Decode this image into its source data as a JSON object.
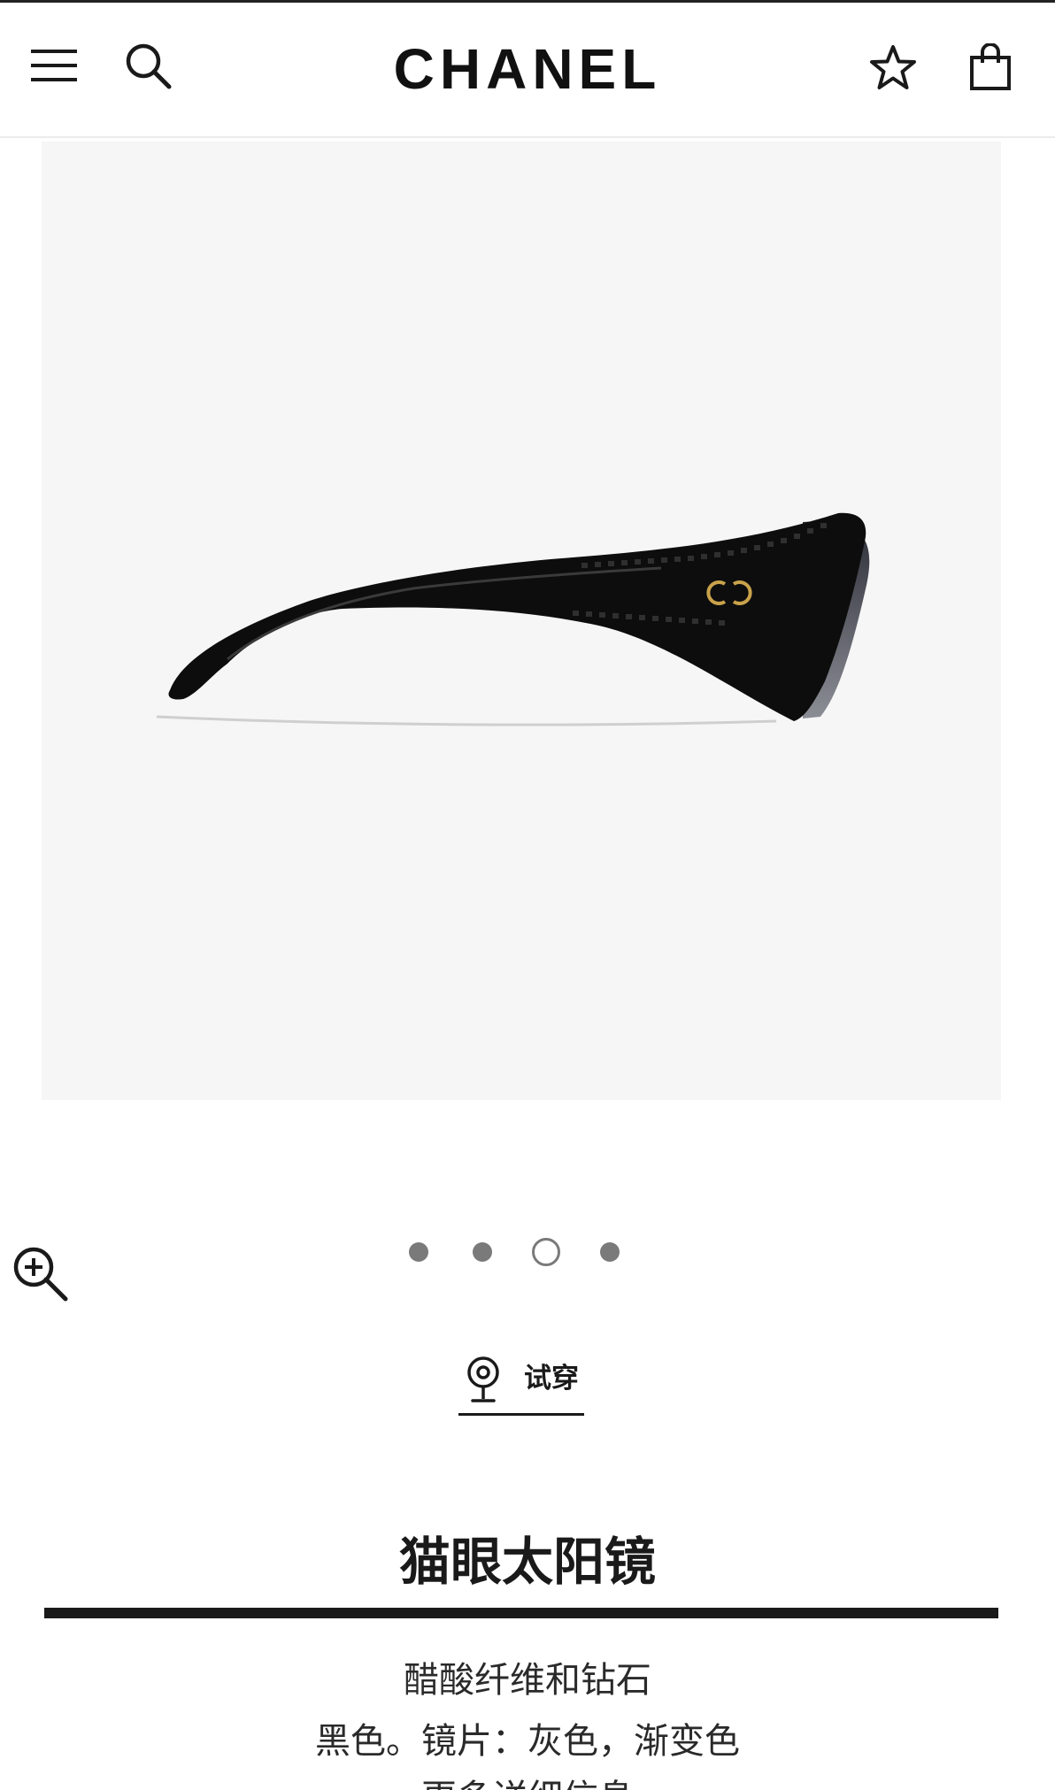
{
  "header": {
    "brand": "CHANEL",
    "icons": [
      "menu-icon",
      "search-icon",
      "star-icon",
      "shopping-bag-icon"
    ]
  },
  "gallery": {
    "image_alt": "黑色猫眼太阳镜侧视图",
    "total_slides": 4,
    "active_slide": 3,
    "zoom_icon": "zoom-in-icon"
  },
  "try_on": {
    "label": "试穿",
    "icon": "location-pin-icon"
  },
  "product": {
    "title": "猫眼太阳镜",
    "material": "醋酸纤维和钻石",
    "color": "黑色。镜片：灰色，渐变色",
    "more_details": "更多详细信息"
  },
  "colors": {
    "text": "#1a1a1a",
    "image_bg": "#f6f6f6",
    "dot": "#7a7a7a",
    "logo_cc": "#c9a24b"
  }
}
